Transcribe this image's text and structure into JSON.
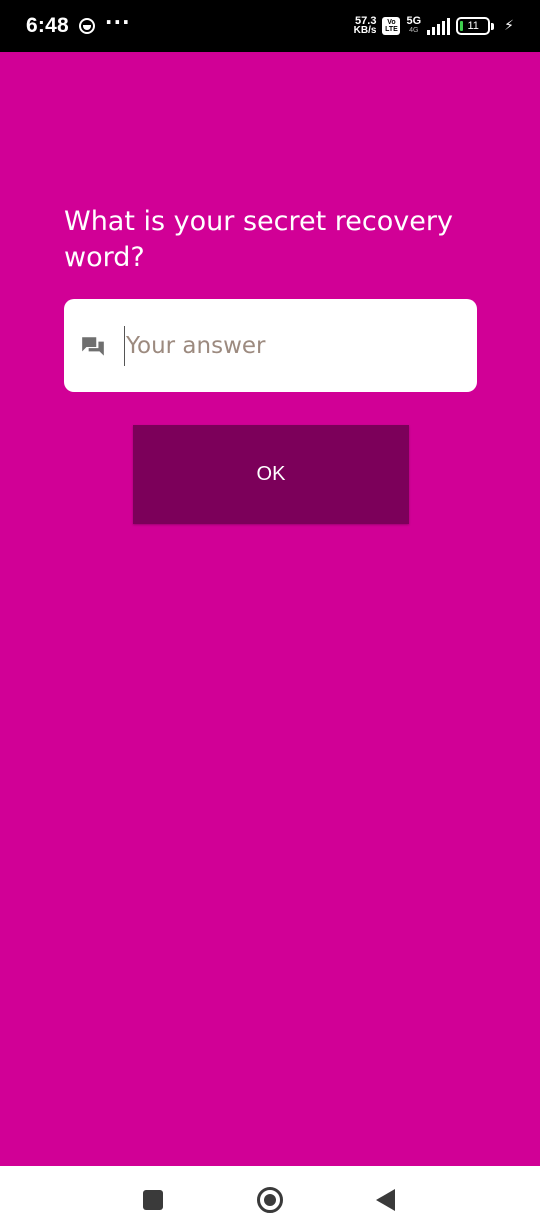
{
  "status_bar": {
    "time": "6:48",
    "more_indicator": "···",
    "net_speed_value": "57.3",
    "net_speed_unit": "KB/s",
    "volte_top": "Vo",
    "volte_bottom": "LTE",
    "network_type": "5G",
    "network_sub": "4G",
    "battery_level": "11"
  },
  "prompt": {
    "question": "What is your secret recovery word?",
    "answer_value": "",
    "answer_placeholder": "Your answer",
    "ok_label": "OK"
  },
  "colors": {
    "background": "#d10096",
    "button": "#7c005a",
    "input_bg": "#ffffff"
  },
  "icons": {
    "answer_field": "chat-bubbles-icon",
    "nav_recents": "square-icon",
    "nav_home": "circle-icon",
    "nav_back": "triangle-back-icon"
  }
}
